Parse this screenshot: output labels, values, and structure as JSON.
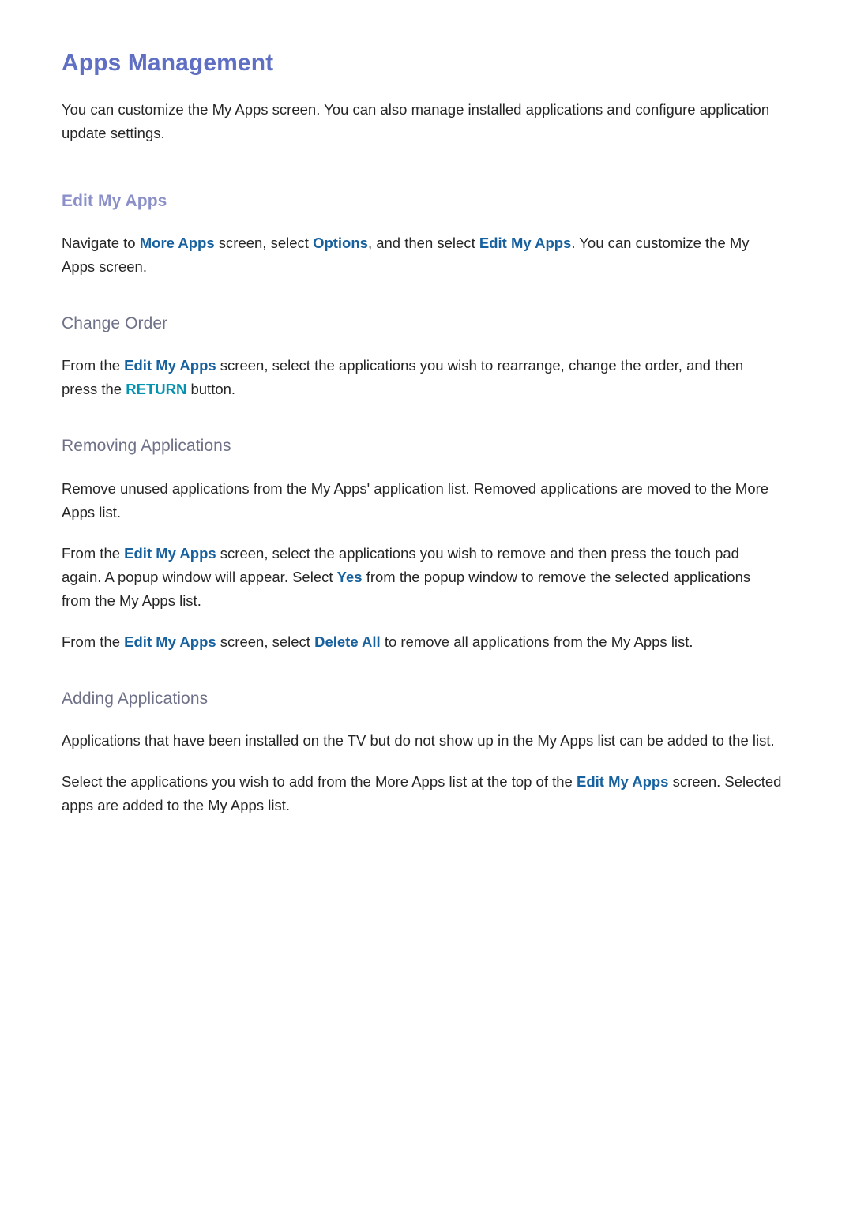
{
  "document": {
    "title": "Apps Management",
    "intro": "You can customize the My Apps screen. You can also manage installed applications and configure application update settings."
  },
  "colors": {
    "title": "#5f6fc4",
    "heading_h2": "#8b90c9",
    "heading_h3": "#6e7187",
    "link": "#17619f",
    "key_button": "#0693b0",
    "body_text": "#262626",
    "background": "#ffffff"
  },
  "sections": {
    "edit_my_apps": {
      "heading": "Edit My Apps",
      "paragraph": {
        "p1": "Navigate to ",
        "link1": "More Apps",
        "p2": " screen, select ",
        "link2": "Options",
        "p3": ", and then select ",
        "link3": "Edit My Apps",
        "p4": ". You can customize the My Apps screen."
      }
    },
    "change_order": {
      "heading": "Change Order",
      "paragraph": {
        "p1": "From the ",
        "link1": "Edit My Apps",
        "p2": " screen, select the applications you wish to rearrange, change the order, and then press the ",
        "key1": "RETURN",
        "p3": " button."
      }
    },
    "removing_applications": {
      "heading": "Removing Applications",
      "paragraph1": "Remove unused applications from the My Apps' application list. Removed applications are moved to the More Apps list.",
      "paragraph2": {
        "p1": "From the ",
        "link1": "Edit My Apps",
        "p2": " screen, select the applications you wish to remove and then press the touch pad again. A popup window will appear. Select ",
        "link2": "Yes",
        "p3": " from the popup window to remove the selected applications from the My Apps list."
      },
      "paragraph3": {
        "p1": "From the ",
        "link1": "Edit My Apps",
        "p2": " screen, select ",
        "link2": "Delete All",
        "p3": " to remove all applications from the My Apps list."
      }
    },
    "adding_applications": {
      "heading": "Adding Applications",
      "paragraph1": "Applications that have been installed on the TV but do not show up in the My Apps list can be added to the list.",
      "paragraph2": {
        "p1": "Select the applications you wish to add from the More Apps list at the top of the ",
        "link1": "Edit My Apps",
        "p2": " screen. Selected apps are added to the My Apps list."
      }
    }
  }
}
